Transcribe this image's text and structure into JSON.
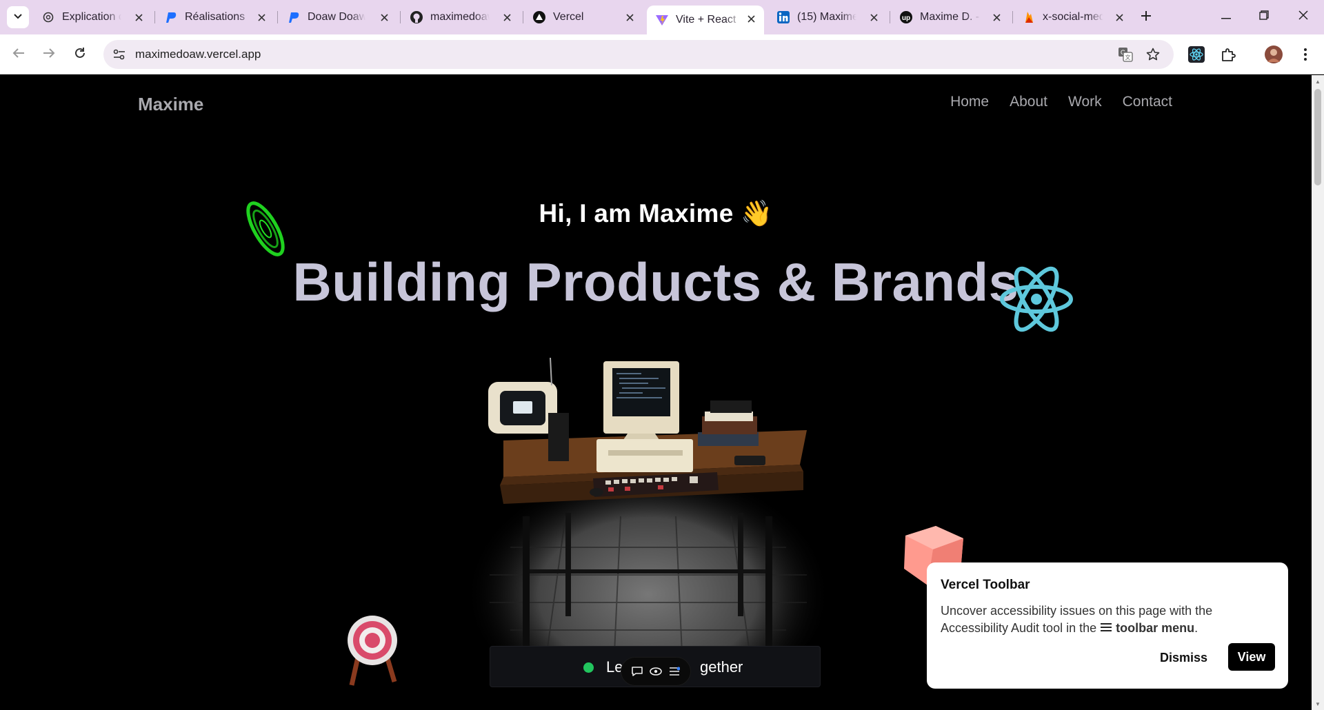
{
  "browser": {
    "tabs": [
      {
        "title": "Explication co",
        "icon": "openai-icon"
      },
      {
        "title": "Réalisations",
        "icon": "publisher-p-icon"
      },
      {
        "title": "Doaw Doaw I",
        "icon": "publisher-p-icon"
      },
      {
        "title": "maximedoaw",
        "icon": "github-icon"
      },
      {
        "title": "Vercel",
        "icon": "vercel-icon"
      },
      {
        "title": "Vite + React",
        "icon": "vite-icon",
        "active": true
      },
      {
        "title": "(15) Maxime",
        "icon": "linkedin-icon"
      },
      {
        "title": "Maxime D. - I",
        "icon": "upwork-icon"
      },
      {
        "title": "x-social-med",
        "icon": "firebase-icon"
      }
    ],
    "url": "maximedoaw.vercel.app"
  },
  "site": {
    "brand": "Maxime",
    "nav": [
      "Home",
      "About",
      "Work",
      "Contact"
    ],
    "greeting": "Hi, I am Maxime 👋",
    "headline": "Building Products & Brands",
    "cta_text_left": "Le",
    "cta_text_right": "gether"
  },
  "vercel_popup": {
    "title": "Vercel Toolbar",
    "body_part1": "Uncover accessibility issues on this page with the Accessibility Audit tool in the",
    "body_bold": "toolbar menu",
    "body_end": ".",
    "dismiss": "Dismiss",
    "view": "View"
  },
  "colors": {
    "tabstrip": "#e8d6ee",
    "status_dot": "#22c55e",
    "headline": "#c7c5d9",
    "react_blue": "#5ec8dc"
  }
}
